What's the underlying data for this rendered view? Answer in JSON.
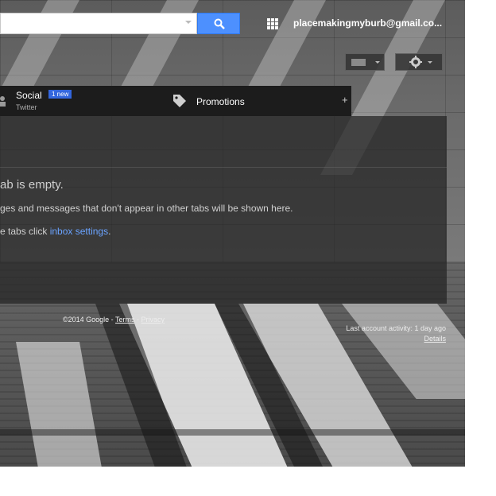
{
  "header": {
    "search_placeholder": "",
    "account_email": "placemakingmyburb@gmail.co..."
  },
  "tabs": {
    "social": {
      "label": "Social",
      "badge": "1 new",
      "subtitle": "Twitter"
    },
    "promotions": {
      "label": "Promotions"
    },
    "add_symbol": "+"
  },
  "empty_state": {
    "heading": "ab is empty.",
    "description": "ges and messages that don't appear in other tabs will be shown here.",
    "hint_prefix": "e tabs click ",
    "hint_link": "inbox settings",
    "hint_suffix": "."
  },
  "footer": {
    "copyright": "©2014 Google - ",
    "terms": "Terms",
    "separator": " - ",
    "privacy": "Privacy",
    "last_activity": "Last account activity: 1 day ago",
    "details": "Details"
  },
  "colors": {
    "search_blue": "#4d90fe",
    "badge_blue": "#3366dd",
    "link_blue": "#6aa3ff"
  },
  "icons": {
    "search": "search-icon",
    "apps": "apps-grid-icon",
    "social": "person-icon",
    "promotions": "tag-icon",
    "settings": "gear-icon"
  }
}
